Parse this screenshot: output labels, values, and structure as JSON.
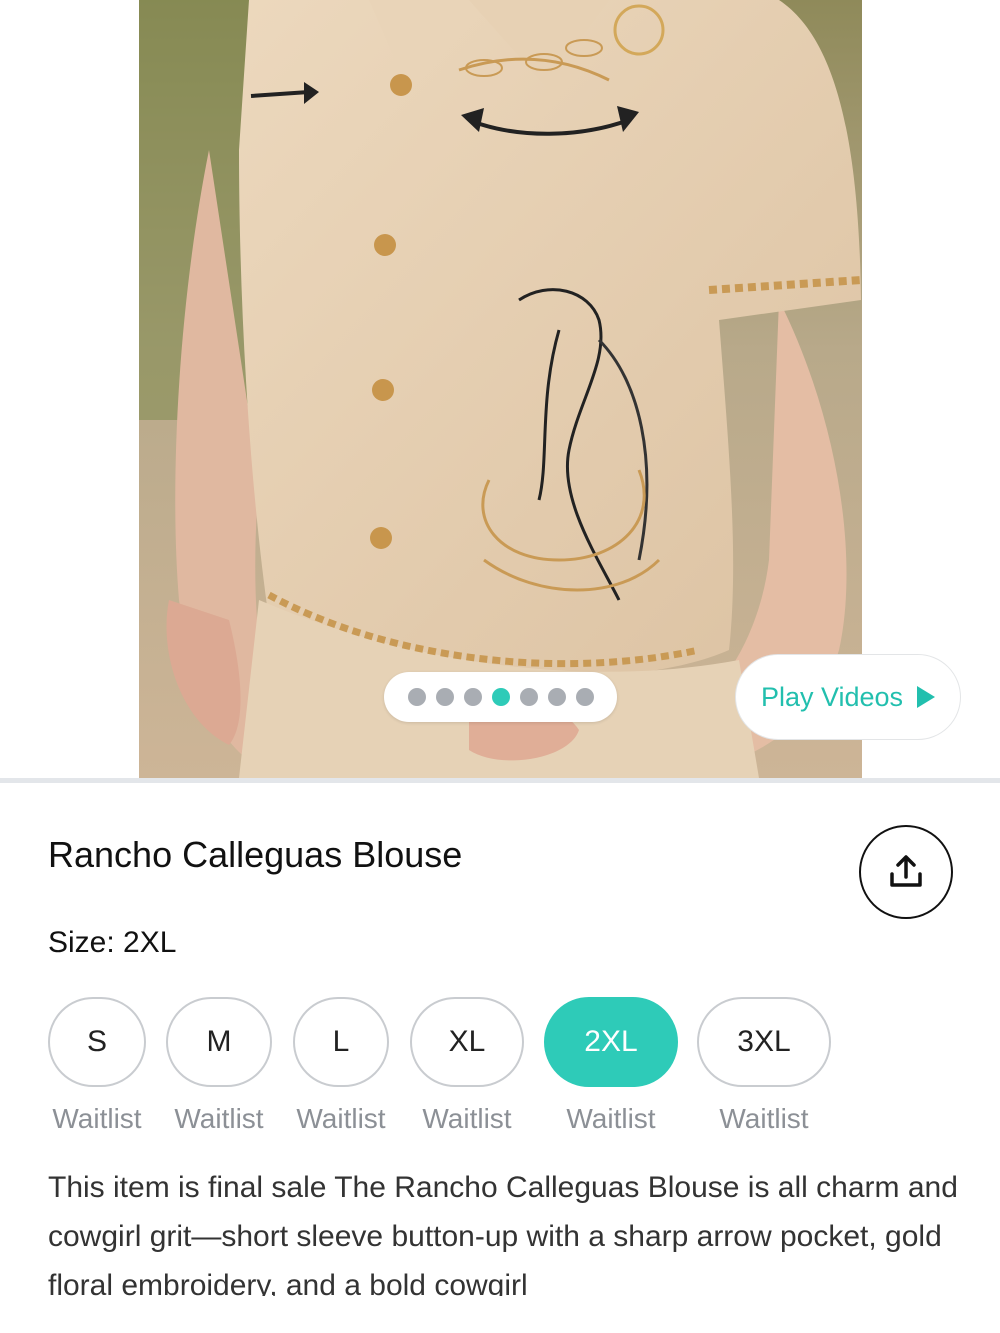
{
  "gallery": {
    "image_alt": "Model wearing tan embroidered short sleeve button-up blouse with horse and rope embroidery",
    "dot_count": 7,
    "active_dot_index": 3,
    "play_videos_label": "Play Videos",
    "play_icon": "play-triangle-icon",
    "accent_color": "#2ecbb8"
  },
  "product": {
    "title": "Rancho Calleguas Blouse",
    "share_icon": "share-upload-icon",
    "size_label": "Size: 2XL",
    "sizes": [
      {
        "label": "S",
        "status": "Waitlist",
        "selected": false
      },
      {
        "label": "M",
        "status": "Waitlist",
        "selected": false
      },
      {
        "label": "L",
        "status": "Waitlist",
        "selected": false
      },
      {
        "label": "XL",
        "status": "Waitlist",
        "selected": false
      },
      {
        "label": "2XL",
        "status": "Waitlist",
        "selected": true
      },
      {
        "label": "3XL",
        "status": "Waitlist",
        "selected": false
      }
    ],
    "description": "This item is final sale The Rancho Calleguas Blouse is all charm and cowgirl grit—short sleeve button-up with a sharp arrow pocket, gold floral embroidery, and a bold cowgirl"
  }
}
